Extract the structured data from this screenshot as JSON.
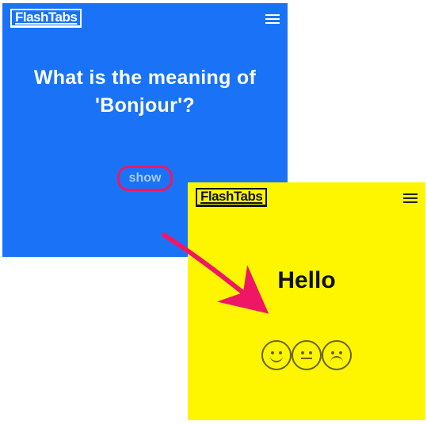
{
  "app_name": "FlashTabs",
  "question_panel": {
    "logo": "FlashTabs",
    "question": "What is the meaning of 'Bonjour'?",
    "show_label": "show"
  },
  "answer_panel": {
    "logo": "FlashTabs",
    "answer": "Hello",
    "ratings": [
      "happy",
      "neutral",
      "sad"
    ]
  },
  "colors": {
    "question_bg": "#1a73f7",
    "answer_bg": "#fdf600",
    "accent": "#ef1765"
  }
}
